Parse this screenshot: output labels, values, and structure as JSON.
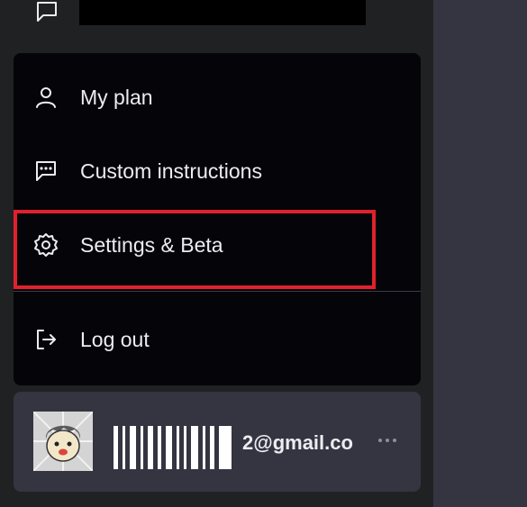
{
  "top_row": {
    "chat_icon": "chat-bubble-icon",
    "title": "(redacted)"
  },
  "menu": {
    "items": [
      {
        "label": "My plan",
        "icon": "user-icon"
      },
      {
        "label": "Custom instructions",
        "icon": "chat-dots-icon"
      },
      {
        "label": "Settings & Beta",
        "icon": "gear-icon"
      },
      {
        "label": "Log out",
        "icon": "logout-icon"
      }
    ],
    "highlight_color": "#e0212d"
  },
  "account": {
    "avatar_icon": "avatar-cartoon",
    "email": "2@gmail.co",
    "more_icon": "ellipsis-icon"
  },
  "colors": {
    "sidebar_bg": "#202123",
    "menu_bg": "#050509",
    "account_bg": "#343541",
    "right_panel_bg": "#343541",
    "text": "#ececf1"
  }
}
